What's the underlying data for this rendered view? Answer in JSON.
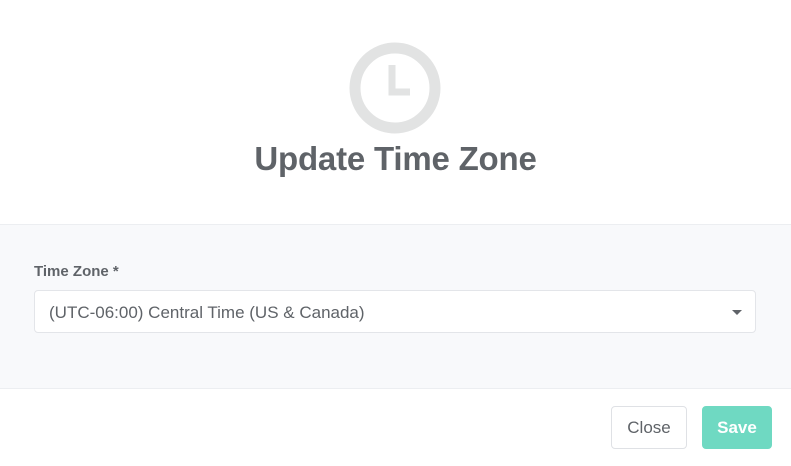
{
  "dialog": {
    "title": "Update Time Zone",
    "icon": "clock-icon"
  },
  "form": {
    "timezone_label": "Time Zone *",
    "timezone_value": "(UTC-06:00) Central Time (US & Canada)"
  },
  "footer": {
    "close_label": "Close",
    "save_label": "Save"
  },
  "colors": {
    "accent": "#6fd9c2",
    "icon_gray": "#e2e3e3",
    "text": "#5f6368",
    "body_bg": "#f8f9fb"
  }
}
